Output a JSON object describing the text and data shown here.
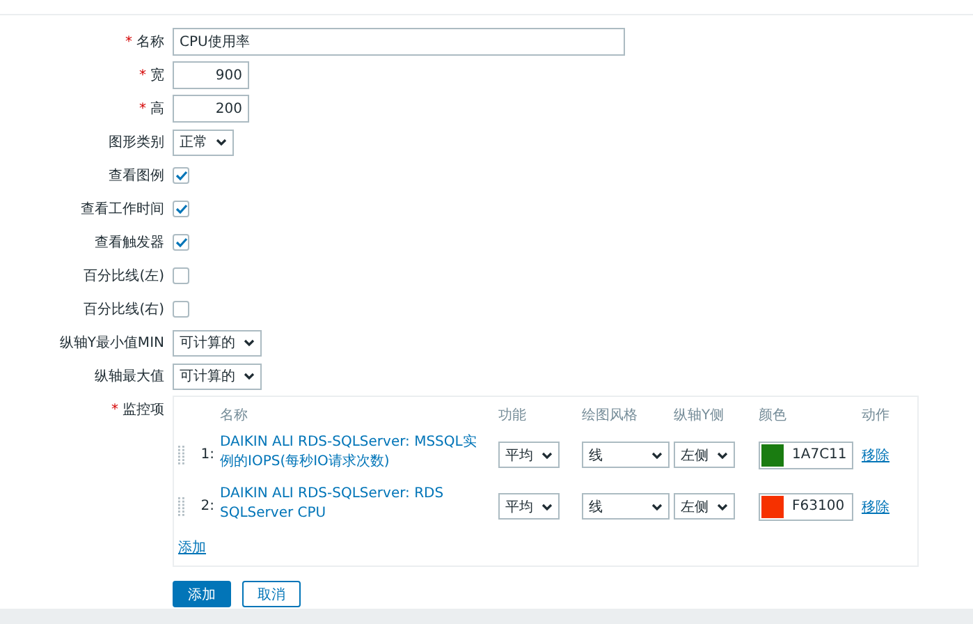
{
  "fields": [
    {
      "kind": "text",
      "label": "名称",
      "required_mark": "*",
      "value": "CPU使用率"
    },
    {
      "kind": "number",
      "label": "宽",
      "required_mark": "*",
      "value": "900"
    },
    {
      "kind": "number",
      "label": "高",
      "required_mark": "*",
      "value": "200"
    },
    {
      "kind": "select",
      "label": "图形类别",
      "value": "正常"
    },
    {
      "kind": "checkbox",
      "label": "查看图例",
      "checked": true
    },
    {
      "kind": "checkbox",
      "label": "查看工作时间",
      "checked": true
    },
    {
      "kind": "checkbox",
      "label": "查看触发器",
      "checked": true
    },
    {
      "kind": "checkbox",
      "label": "百分比线(左)",
      "checked": false
    },
    {
      "kind": "checkbox",
      "label": "百分比线(右)",
      "checked": false
    },
    {
      "kind": "select",
      "label": "纵轴Y最小值MIN",
      "value": "可计算的"
    },
    {
      "kind": "select",
      "label": "纵轴最大值",
      "value": "可计算的"
    }
  ],
  "items": {
    "label": "监控项",
    "required_mark": "*",
    "columns": [
      "名称",
      "功能",
      "绘图风格",
      "纵轴Y侧",
      "颜色",
      "动作"
    ],
    "rows": [
      {
        "number": "1:",
        "name": "DAIKIN ALI RDS-SQLServer: MSSQL实例的IOPS(每秒IO请求次数)",
        "function": "平均",
        "style": "线",
        "axis": "左侧",
        "color": "#1a7c11",
        "color_code": "1A7C11",
        "action": "移除"
      },
      {
        "number": "2:",
        "name": "DAIKIN ALI RDS-SQLServer: RDS SQLServer CPU",
        "function": "平均",
        "style": "线",
        "axis": "左侧",
        "color": "#f63100",
        "color_code": "F63100",
        "action": "移除"
      }
    ],
    "add_link": "添加"
  },
  "buttons": [
    {
      "label": "添加",
      "primary": true
    },
    {
      "label": "取消",
      "primary": false
    }
  ]
}
